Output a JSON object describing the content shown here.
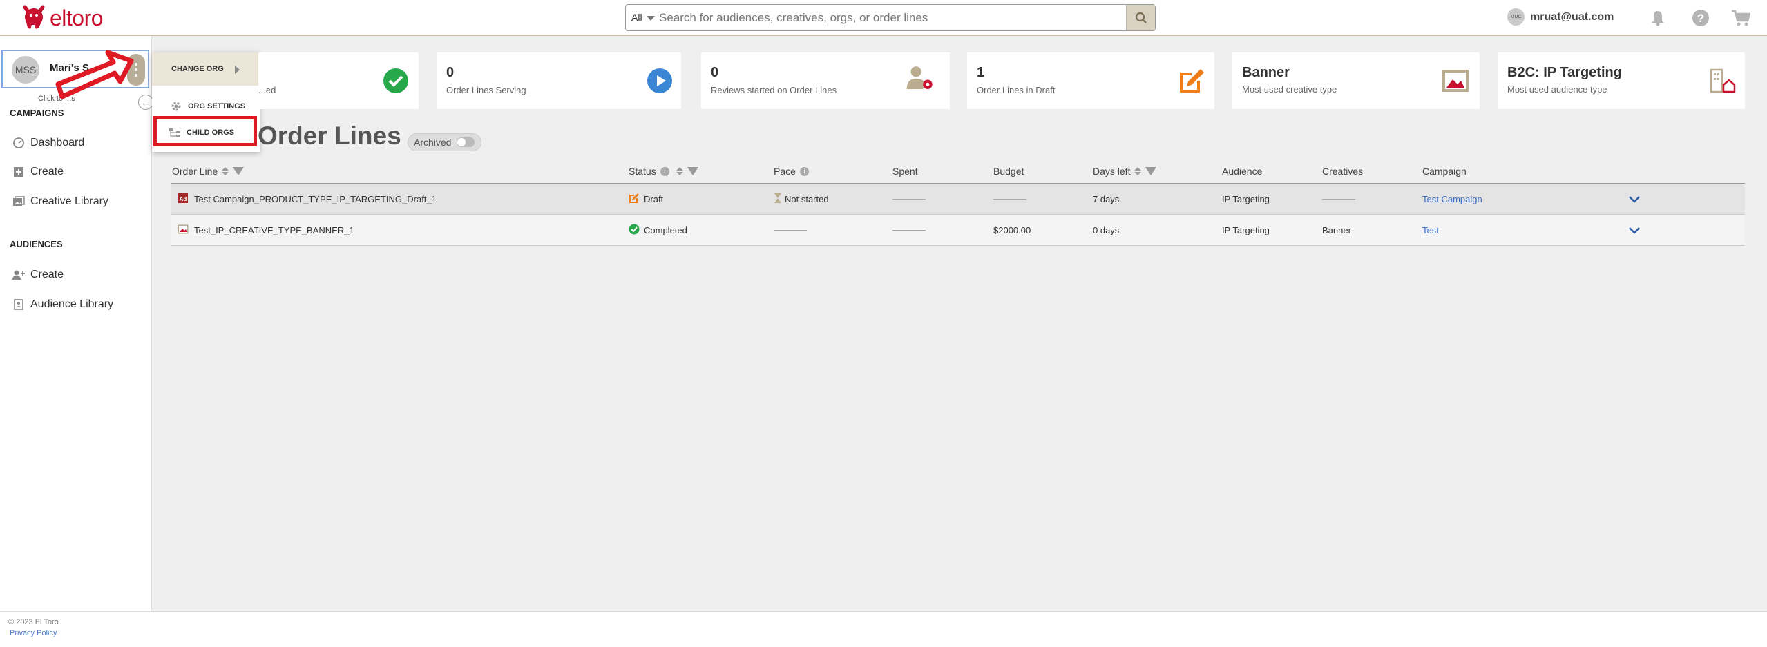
{
  "app": {
    "brand": "eltoro"
  },
  "search": {
    "scope": "All",
    "placeholder": "Search for audiences, creatives, orgs, or order lines"
  },
  "user": {
    "initials": "MUC",
    "email": "mruat@uat.com"
  },
  "org": {
    "initials": "MSS",
    "name": "Mari's S...",
    "hint": "Click to ...s"
  },
  "sidebar": {
    "campaigns_title": "CAMPAIGNS",
    "campaign_items": [
      "Dashboard",
      "Create",
      "Creative Library"
    ],
    "audiences_title": "AUDIENCES",
    "audience_items": [
      "Create",
      "Audience Library"
    ]
  },
  "org_menu": {
    "change_org": "CHANGE ORG",
    "org_settings": "ORG SETTINGS",
    "child_orgs": "CHILD ORGS"
  },
  "cards": [
    {
      "value": "",
      "label": "...ed",
      "icon": "check-circle-icon"
    },
    {
      "value": "0",
      "label": "Order Lines Serving",
      "icon": "play-circle-icon"
    },
    {
      "value": "0",
      "label": "Reviews started on Order Lines",
      "icon": "user-gear-icon"
    },
    {
      "value": "1",
      "label": "Order Lines in Draft",
      "icon": "edit-icon"
    },
    {
      "value": "Banner",
      "label": "Most used creative type",
      "icon": "image-icon"
    },
    {
      "value": "B2C: IP Targeting",
      "label": "Most used audience type",
      "icon": "building-icon"
    }
  ],
  "page": {
    "title": "Order Lines",
    "archived_label": "Archived"
  },
  "table": {
    "columns": [
      "Order Line",
      "Status",
      "Pace",
      "Spent",
      "Budget",
      "Days left",
      "Audience",
      "Creatives",
      "Campaign"
    ],
    "rows": [
      {
        "order_line": "Test Campaign_PRODUCT_TYPE_IP_TARGETING_Draft_1",
        "status": "Draft",
        "pace": "Not started",
        "spent": "",
        "budget": "",
        "days_left": "7 days",
        "audience": "IP Targeting",
        "creatives": "",
        "campaign": "Test Campaign"
      },
      {
        "order_line": "Test_IP_CREATIVE_TYPE_BANNER_1",
        "status": "Completed",
        "pace": "",
        "spent": "",
        "budget": "$2000.00",
        "days_left": "0 days",
        "audience": "IP Targeting",
        "creatives": "Banner",
        "campaign": "Test"
      }
    ]
  },
  "footer": {
    "copyright": "© 2023 El Toro",
    "privacy": "Privacy Policy"
  },
  "colors": {
    "brand_red": "#c8102e",
    "accent_tan": "#b8ae97",
    "highlight_red": "#e01a24",
    "link_blue": "#3d70c4"
  }
}
